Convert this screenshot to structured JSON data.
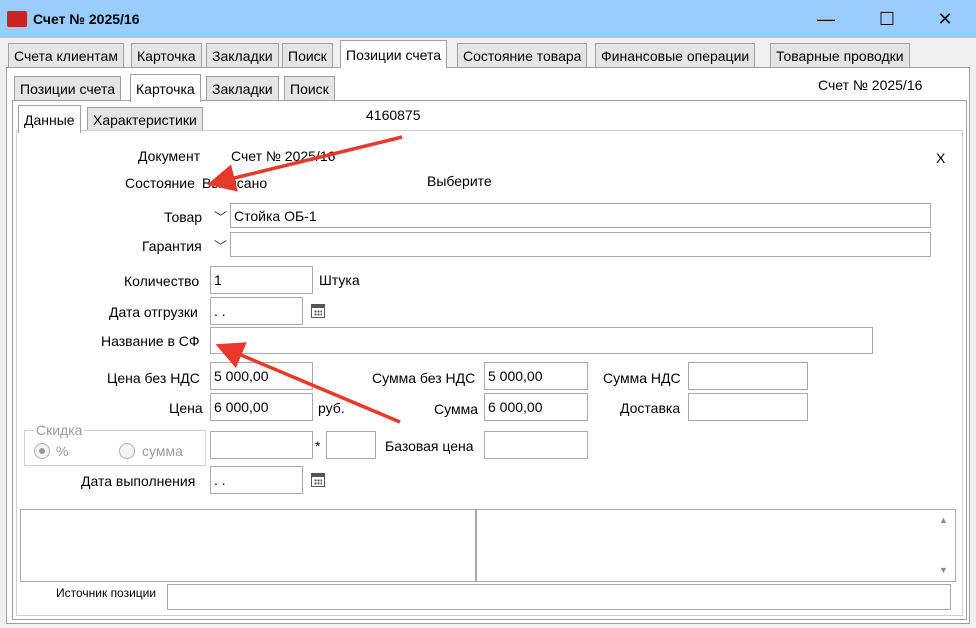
{
  "window": {
    "title": "Счет № 2025/16",
    "minimize": "—",
    "maximize": "☐",
    "close": "✕"
  },
  "colors": {
    "titlebar": "#99ccff",
    "arrow": "#e8392a"
  },
  "top_tabs": [
    "Счета клиентам",
    "Карточка",
    "Закладки",
    "Поиск",
    "Позиции счета",
    "Состояние товара",
    "Финансовые операции",
    "Товарные проводки"
  ],
  "second_tabs": [
    "Позиции счета",
    "Карточка",
    "Закладки",
    "Поиск"
  ],
  "header_right": "Счет № 2025/16",
  "third_tabs": [
    "Данные",
    "Характеристики"
  ],
  "item_code": "4160875",
  "form": {
    "document_label": "Документ",
    "document_value": "Счет № 2025/16",
    "close_x": "X",
    "state_label": "Состояние",
    "state_value": "Выписано",
    "choose": "Выберите",
    "product_label": "Товар",
    "product_value": "Стойка ОБ-1",
    "warranty_label": "Гарантия",
    "warranty_value": "",
    "qty_label": "Количество",
    "qty_value": "1",
    "unit": "Штука",
    "ship_date_label": "Дата отгрузки",
    "ship_date_value": " .  .",
    "sf_name_label": "Название в СФ",
    "sf_name_value": "",
    "price_novat_label": "Цена без НДС",
    "price_novat_value": "5 000,00",
    "sum_novat_label": "Сумма без НДС",
    "sum_novat_value": "5 000,00",
    "vat_sum_label": "Сумма НДС",
    "vat_sum_value": "",
    "price_label": "Цена",
    "price_value": "6 000,00",
    "currency": "руб.",
    "sum_label": "Сумма",
    "sum_value": "6 000,00",
    "delivery_label": "Доставка",
    "delivery_value": "",
    "discount_group": "Скидка",
    "discount_percent": "%",
    "discount_sum": "сумма",
    "discount_value": "",
    "multiply": "*",
    "multiplier_value": "",
    "base_price_label": "Базовая цена",
    "base_price_value": "",
    "done_date_label": "Дата выполнения",
    "done_date_value": " .  .",
    "source_label": "Источник позиции",
    "source_value": ""
  },
  "icons": {
    "combo": "chevron-down-icon",
    "calendar": "calendar-icon",
    "scroll_up": "▲",
    "scroll_down": "▼"
  }
}
